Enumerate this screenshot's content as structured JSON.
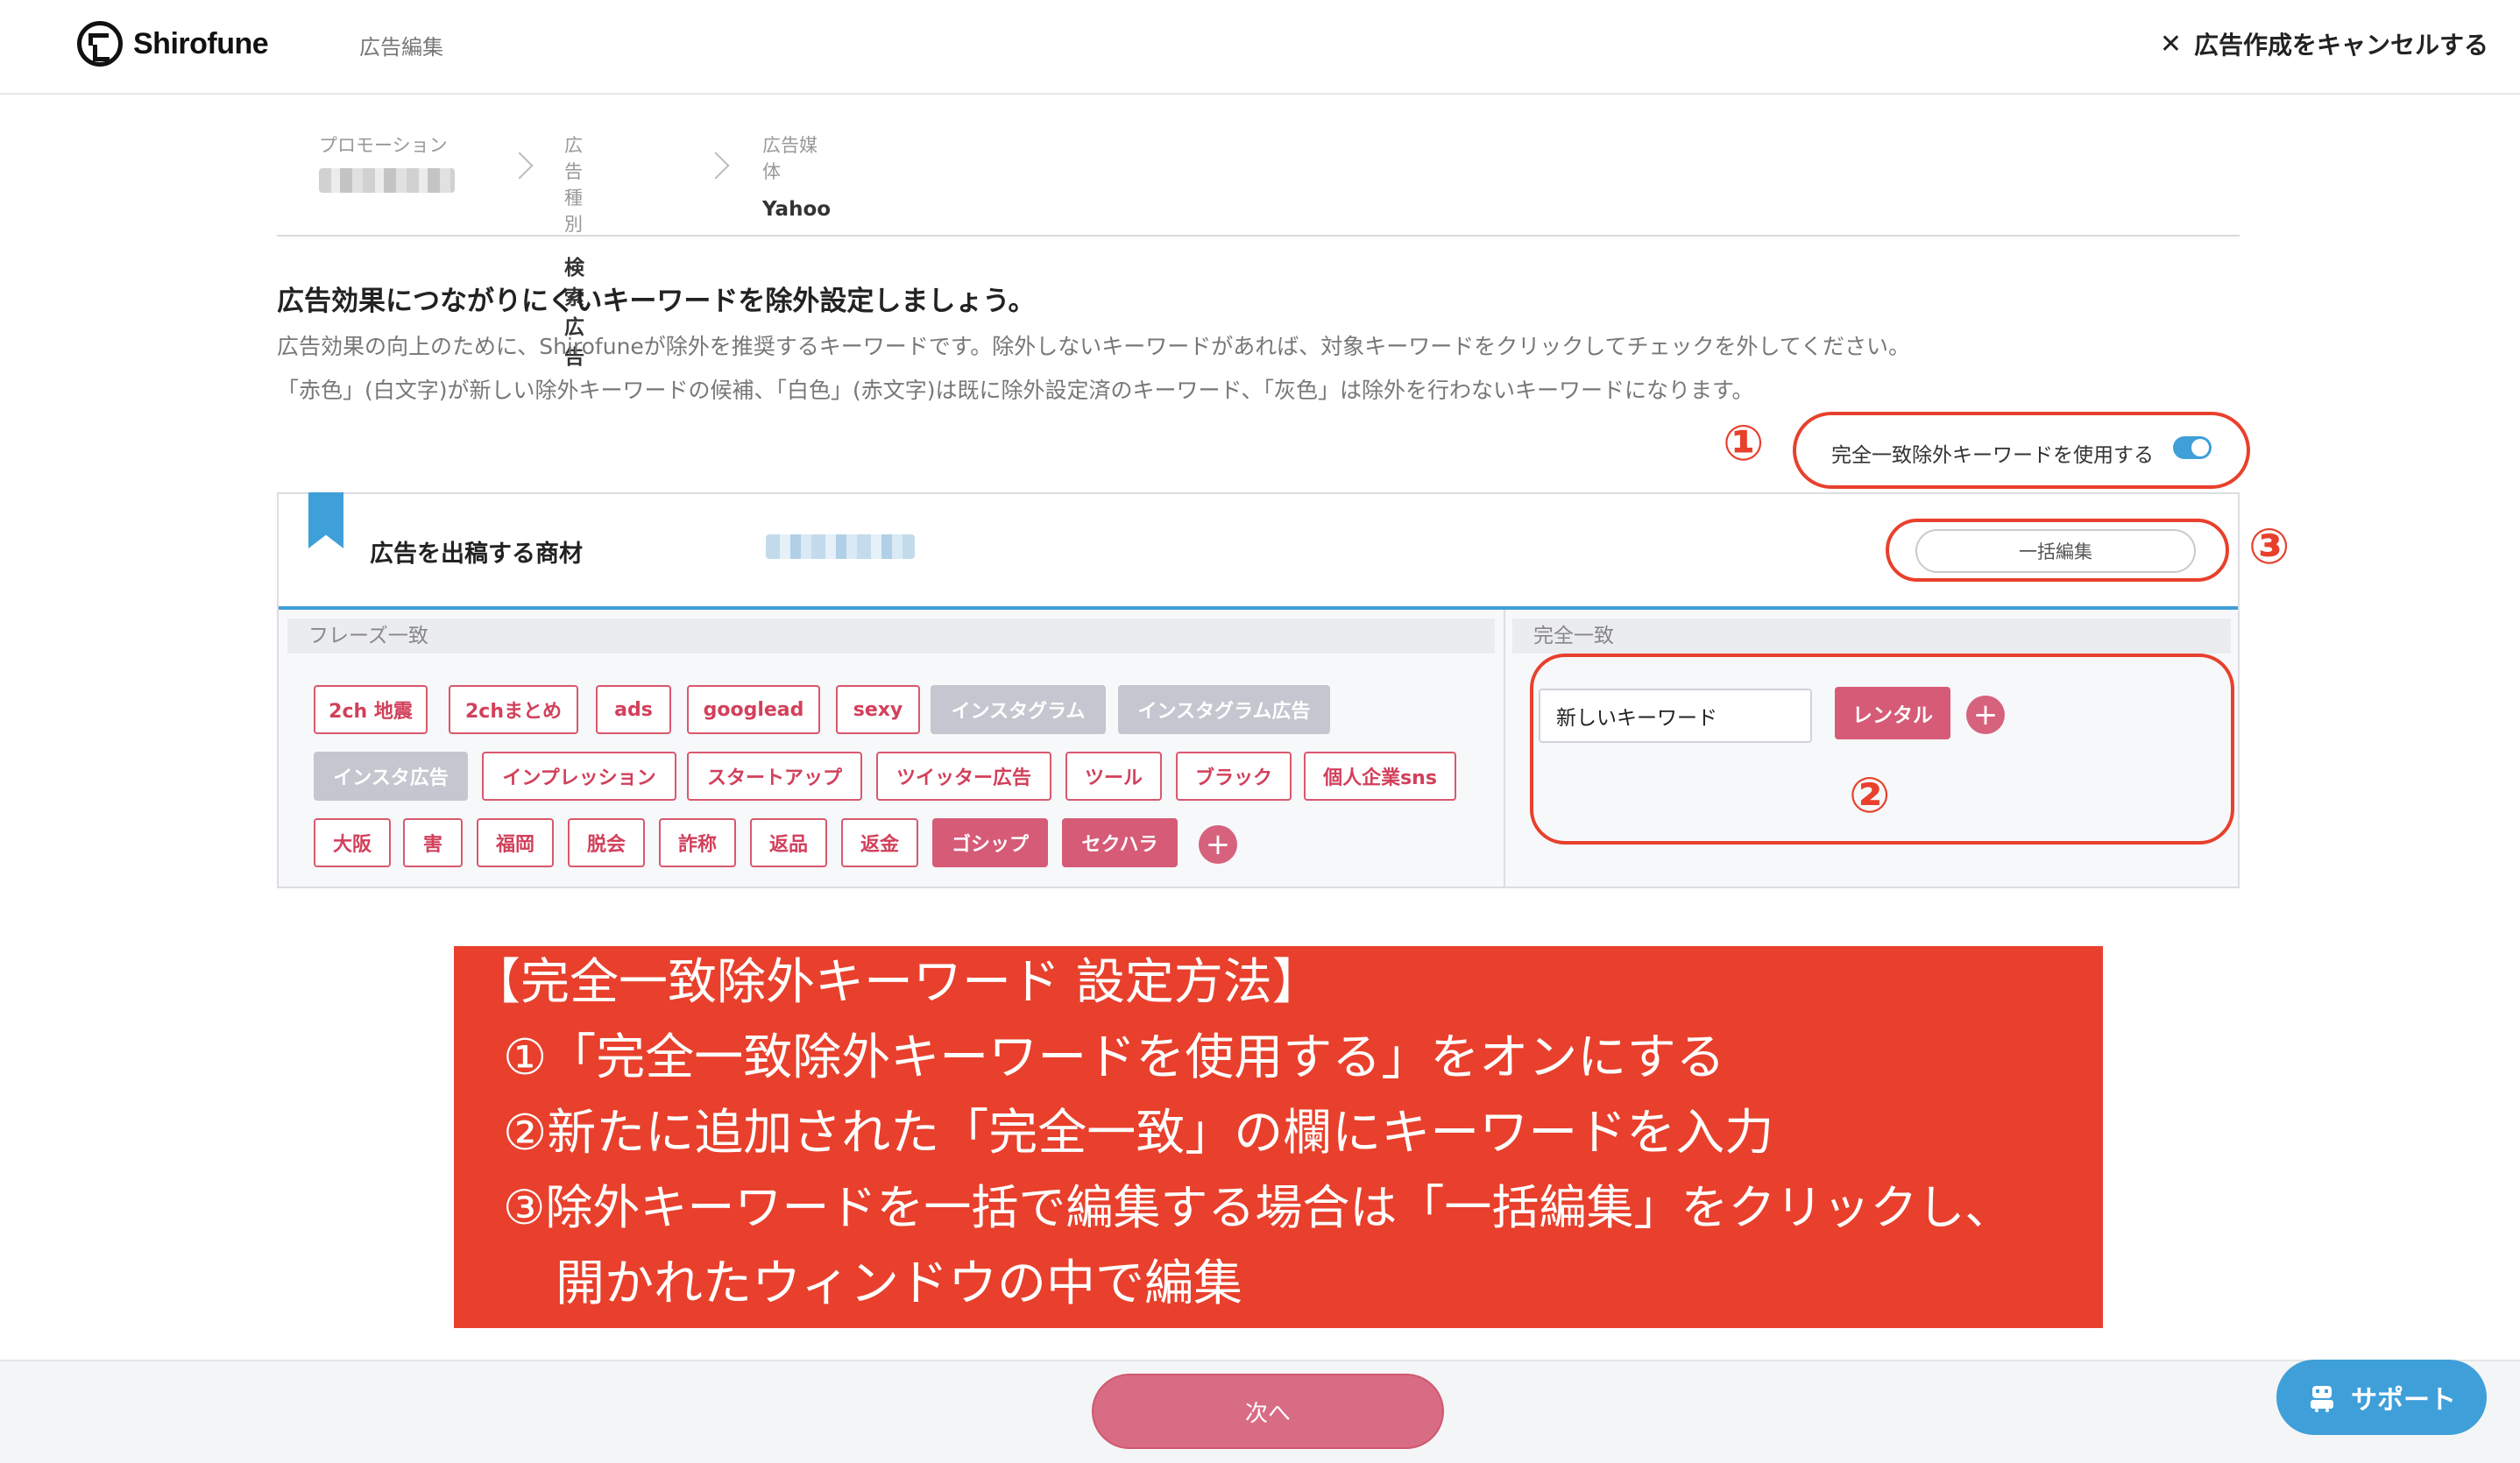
{
  "header": {
    "logo_text": "Shirofune",
    "page_label": "広告編集",
    "cancel_label": "広告作成をキャンセルする"
  },
  "breadcrumb": [
    {
      "label": "プロモーション",
      "value": ""
    },
    {
      "label": "広告種別",
      "value": "検索広告"
    },
    {
      "label": "広告媒体",
      "value": "Yahoo"
    }
  ],
  "intro": {
    "title": "広告効果につながりにくいキーワードを除外設定しましょう。",
    "desc1": "広告効果の向上のために、Shirofuneが除外を推奨するキーワードです。除外しないキーワードがあれば、対象キーワードをクリックしてチェックを外してください。",
    "desc2": "「赤色」(白文字)が新しい除外キーワードの候補、「白色」(赤文字)は既に除外設定済のキーワード、「灰色」は除外を行わないキーワードになります。"
  },
  "toggle": {
    "label": "完全一致除外キーワードを使用する",
    "state": "on"
  },
  "markers": {
    "one": "①",
    "two": "②",
    "three": "③"
  },
  "card": {
    "title": "広告を出稿する商材",
    "bulk_edit_label": "一括編集",
    "phrase_header": "フレーズ一致",
    "exact_header": "完全一致",
    "phrase_tags": [
      {
        "text": "2ch 地震",
        "state": "white"
      },
      {
        "text": "2chまとめ",
        "state": "white"
      },
      {
        "text": "ads",
        "state": "white"
      },
      {
        "text": "googlead",
        "state": "white"
      },
      {
        "text": "sexy",
        "state": "white"
      },
      {
        "text": "インスタグラム",
        "state": "gray"
      },
      {
        "text": "インスタグラム広告",
        "state": "gray"
      },
      {
        "text": "インスタ広告",
        "state": "gray"
      },
      {
        "text": "インプレッション",
        "state": "white"
      },
      {
        "text": "スタートアップ",
        "state": "white"
      },
      {
        "text": "ツイッター広告",
        "state": "white"
      },
      {
        "text": "ツール",
        "state": "white"
      },
      {
        "text": "ブラック",
        "state": "white"
      },
      {
        "text": "個人企業sns",
        "state": "white"
      },
      {
        "text": "大阪",
        "state": "white"
      },
      {
        "text": "害",
        "state": "white"
      },
      {
        "text": "福岡",
        "state": "white"
      },
      {
        "text": "脱会",
        "state": "white"
      },
      {
        "text": "詐称",
        "state": "white"
      },
      {
        "text": "返品",
        "state": "white"
      },
      {
        "text": "返金",
        "state": "white"
      },
      {
        "text": "ゴシップ",
        "state": "red"
      },
      {
        "text": "セクハラ",
        "state": "red"
      }
    ],
    "exact_input_value": "新しいキーワード",
    "exact_tags": [
      {
        "text": "レンタル",
        "state": "red"
      }
    ],
    "plus_symbol": "+"
  },
  "guide": {
    "title": "【完全一致除外キーワード 設定方法】",
    "line1": "①「完全一致除外キーワードを使用する」をオンにする",
    "line2": "②新たに追加された「完全一致」の欄にキーワードを入力",
    "line3": "③除外キーワードを一括で編集する場合は「一括編集」をクリックし、",
    "line4": "開かれたウィンドウの中で編集"
  },
  "footer": {
    "next_label": "次へ",
    "support_label": "サポート"
  },
  "colors": {
    "accent_blue": "#3f9fd9",
    "tag_red": "#d65b77",
    "annotation_red": "#e8402c",
    "tag_gray": "#c4c7cf"
  }
}
